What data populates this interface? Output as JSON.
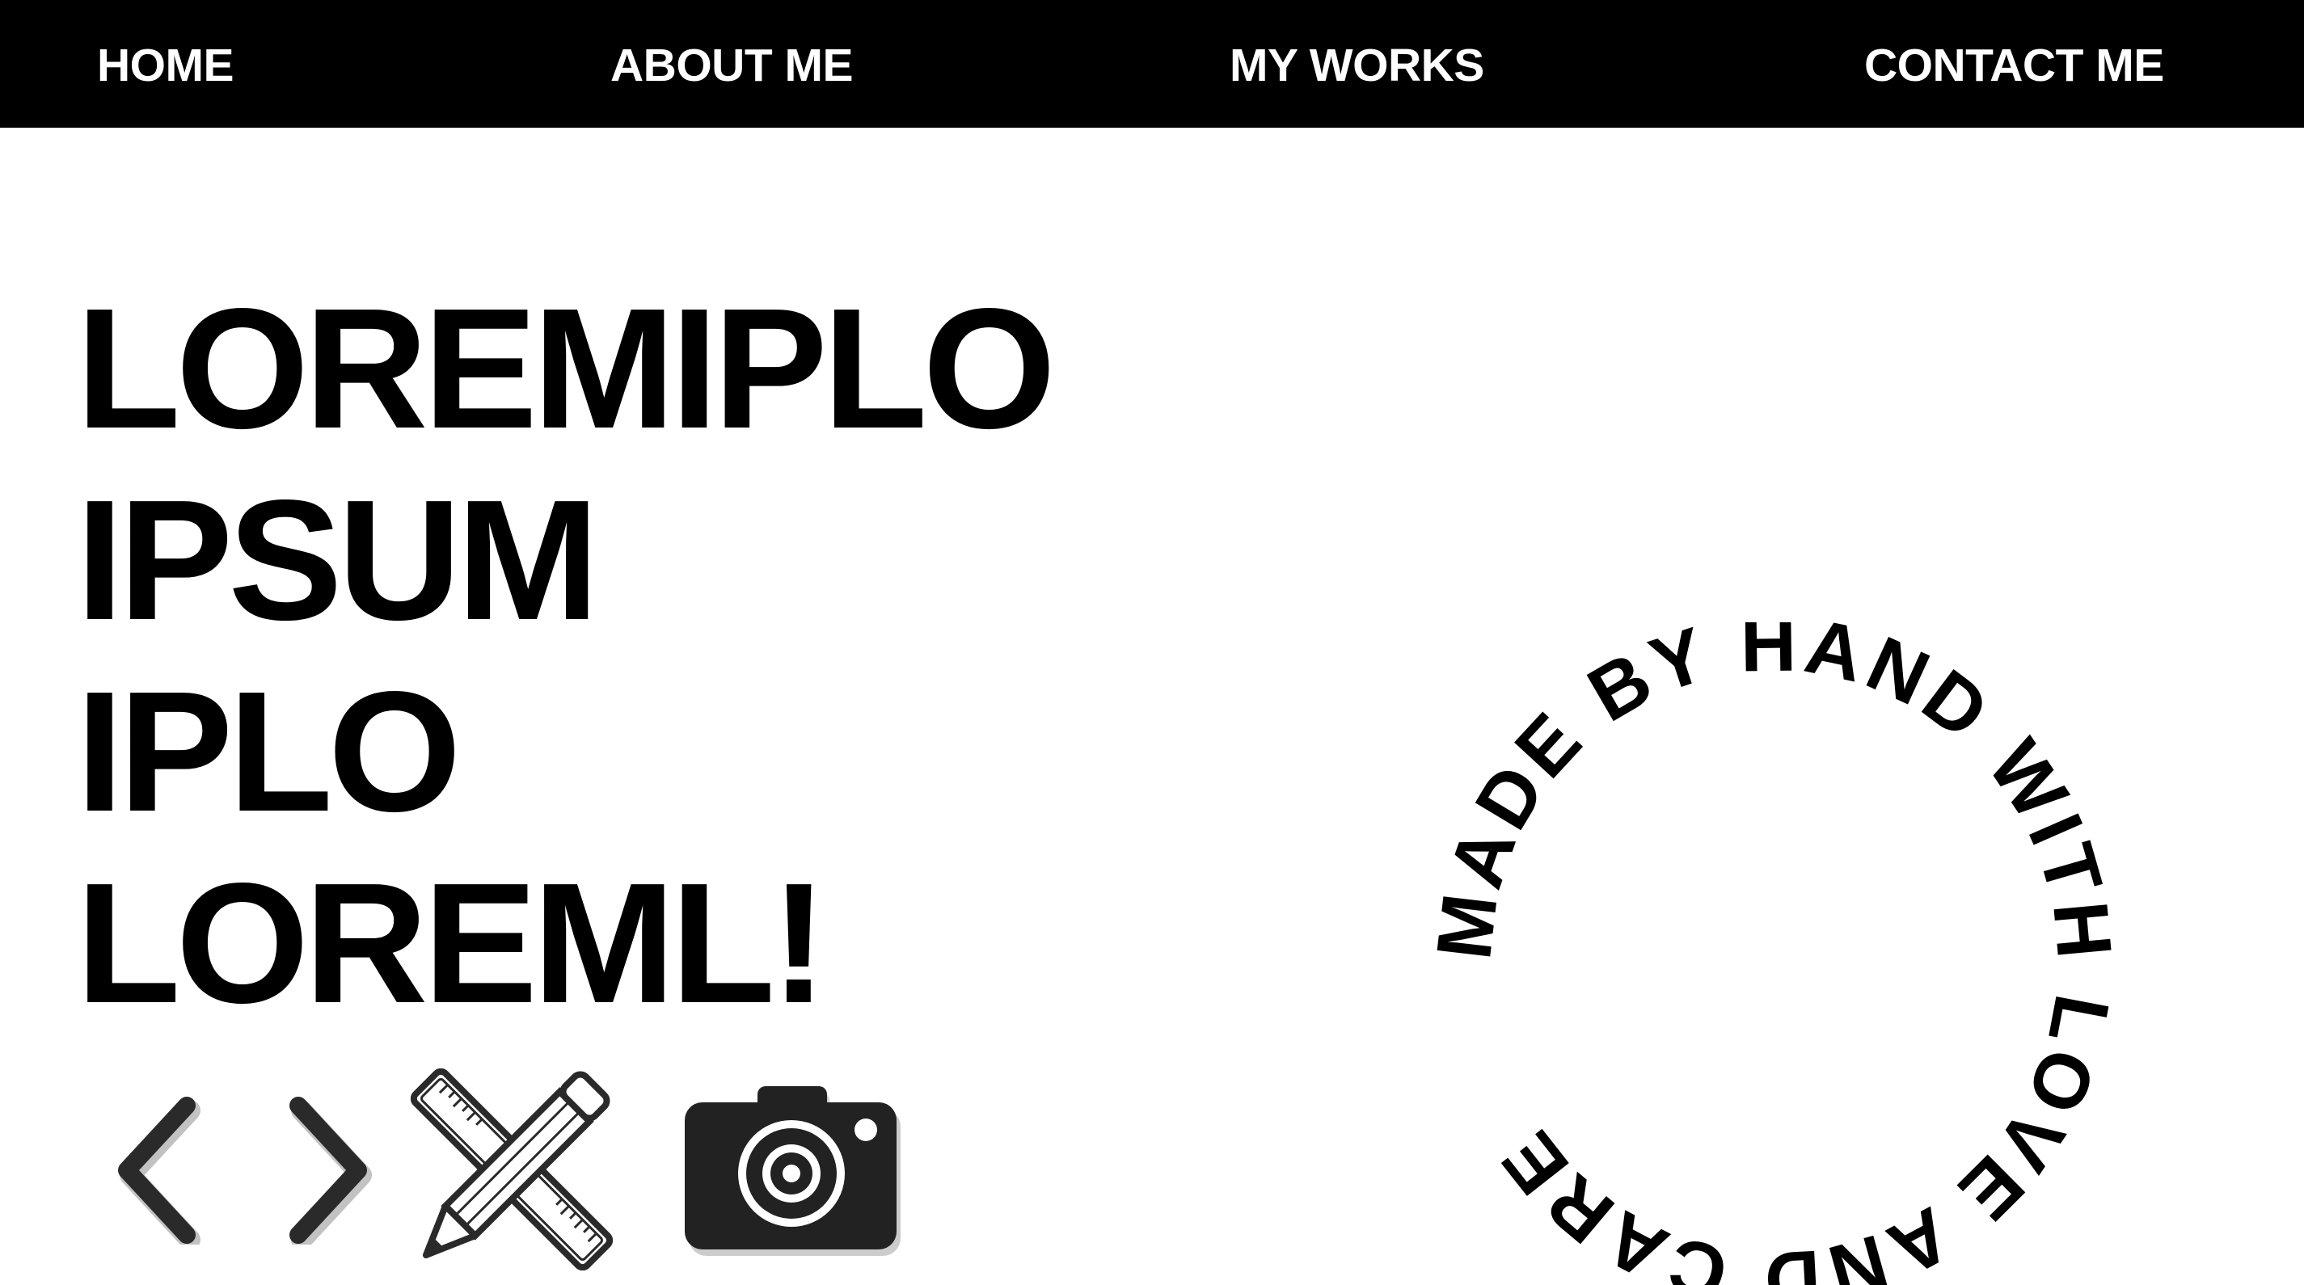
{
  "nav": {
    "items": [
      {
        "label": "HOME"
      },
      {
        "label": "ABOUT ME"
      },
      {
        "label": "MY WORKS"
      },
      {
        "label": "CONTACT ME"
      }
    ]
  },
  "hero": {
    "lines": [
      "LOREMIPLO",
      "IPSUM",
      "IPLO",
      "LOREML!"
    ]
  },
  "icons": [
    "code-brackets-icon",
    "pencil-ruler-icon",
    "camera-icon"
  ],
  "badge": {
    "text": "MADE BY HAND WITH LOVE AND CARE"
  },
  "colors": {
    "background": "#ffffff",
    "nav_background": "#000000",
    "nav_text": "#ffffff",
    "text": "#000000",
    "icon_fill": "#222222"
  }
}
